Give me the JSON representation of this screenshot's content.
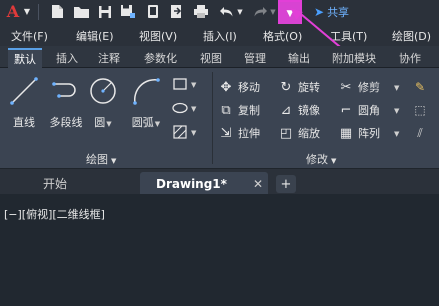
{
  "qat": {
    "logo": "A",
    "share_label": "共享"
  },
  "menu": [
    "文件(F)",
    "编辑(E)",
    "视图(V)",
    "插入(I)",
    "格式(O)",
    "工具(T)",
    "绘图(D)"
  ],
  "ribbon_tabs": [
    "默认",
    "插入",
    "注释",
    "参数化",
    "视图",
    "管理",
    "输出",
    "附加模块",
    "协作"
  ],
  "draw_panel": {
    "title": "绘图",
    "buttons": [
      "直线",
      "多段线",
      "圆",
      "圆弧"
    ]
  },
  "modify_panel": {
    "title": "修改",
    "rows": [
      [
        "移动",
        "旋转",
        "修剪"
      ],
      [
        "复制",
        "镜像",
        "圆角"
      ],
      [
        "拉伸",
        "缩放",
        "阵列"
      ]
    ]
  },
  "doc_tabs": {
    "start": "开始",
    "active": "Drawing1*",
    "close": "✕",
    "add": "+"
  },
  "viewport": {
    "label": "[−][俯视][二维线框]"
  },
  "colors": {
    "highlight": "#e23fd7",
    "logo": "#e03a3a",
    "share": "#6fb3ff"
  }
}
